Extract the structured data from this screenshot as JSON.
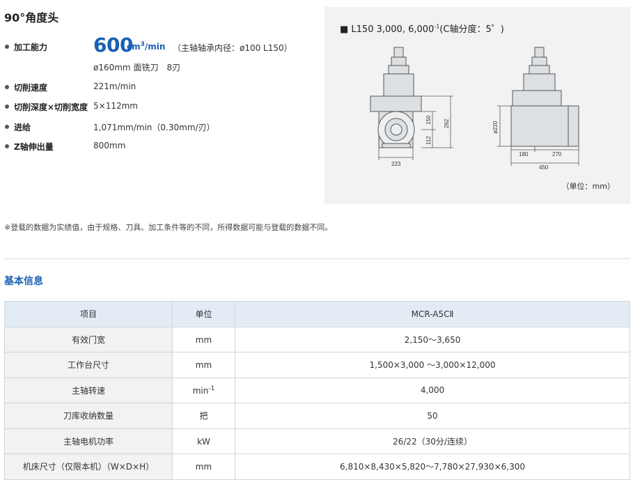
{
  "heading": "90°角度头",
  "specs": {
    "capacity": {
      "label": "加工能力",
      "value": "600",
      "unit_base": "cm",
      "unit_exp": "3",
      "unit_rest": "/min",
      "note": "（主轴轴承内径：ø100 L150）",
      "line2": "ø160mm 面铣刀　8刃"
    },
    "cutting_speed": {
      "label": "切削速度",
      "value": "221m/min"
    },
    "cut_depth_width": {
      "label": "切削深度×切削宽度",
      "value": "5×112mm"
    },
    "feed": {
      "label": "进给",
      "value": "1,071mm/min（0.30mm/刃）"
    },
    "z_extension": {
      "label": "Z轴伸出量",
      "value": "800mm"
    }
  },
  "diagram": {
    "title_pre": "■ L150 3,000, 6,000",
    "title_sup": "-1",
    "title_post": "(C轴分度：5゜)",
    "dims": {
      "d150": "150",
      "d262": "262",
      "d112": "112",
      "d223": "223",
      "d220": "ø220",
      "d180": "180",
      "d270": "270",
      "d450": "450"
    },
    "unit_note": "（单位：mm）"
  },
  "note": "※登载的数据为实绩值，由于规格、刀具、加工条件等的不同，所得数据可能与登载的数据不同。",
  "section_title": "基本信息",
  "table": {
    "headers": [
      "项目",
      "单位",
      "MCR-A5CⅡ"
    ],
    "rows": [
      {
        "item": "有效门宽",
        "unit": "mm",
        "unit_sup": "",
        "value": "2,150～3,650"
      },
      {
        "item": "工作台尺寸",
        "unit": "mm",
        "unit_sup": "",
        "value": "1,500×3,000 ～3,000×12,000"
      },
      {
        "item": "主轴转速",
        "unit": "min",
        "unit_sup": "-1",
        "value": "4,000"
      },
      {
        "item": "刀库收纳数量",
        "unit": "把",
        "unit_sup": "",
        "value": "50"
      },
      {
        "item": "主轴电机功率",
        "unit": "kW",
        "unit_sup": "",
        "value": "26/22（30分/连续）"
      },
      {
        "item": "机床尺寸（仅限本机）（W×D×H）",
        "unit": "mm",
        "unit_sup": "",
        "value": "6,810×8,430×5,820～7,780×27,930×6,300"
      }
    ]
  }
}
